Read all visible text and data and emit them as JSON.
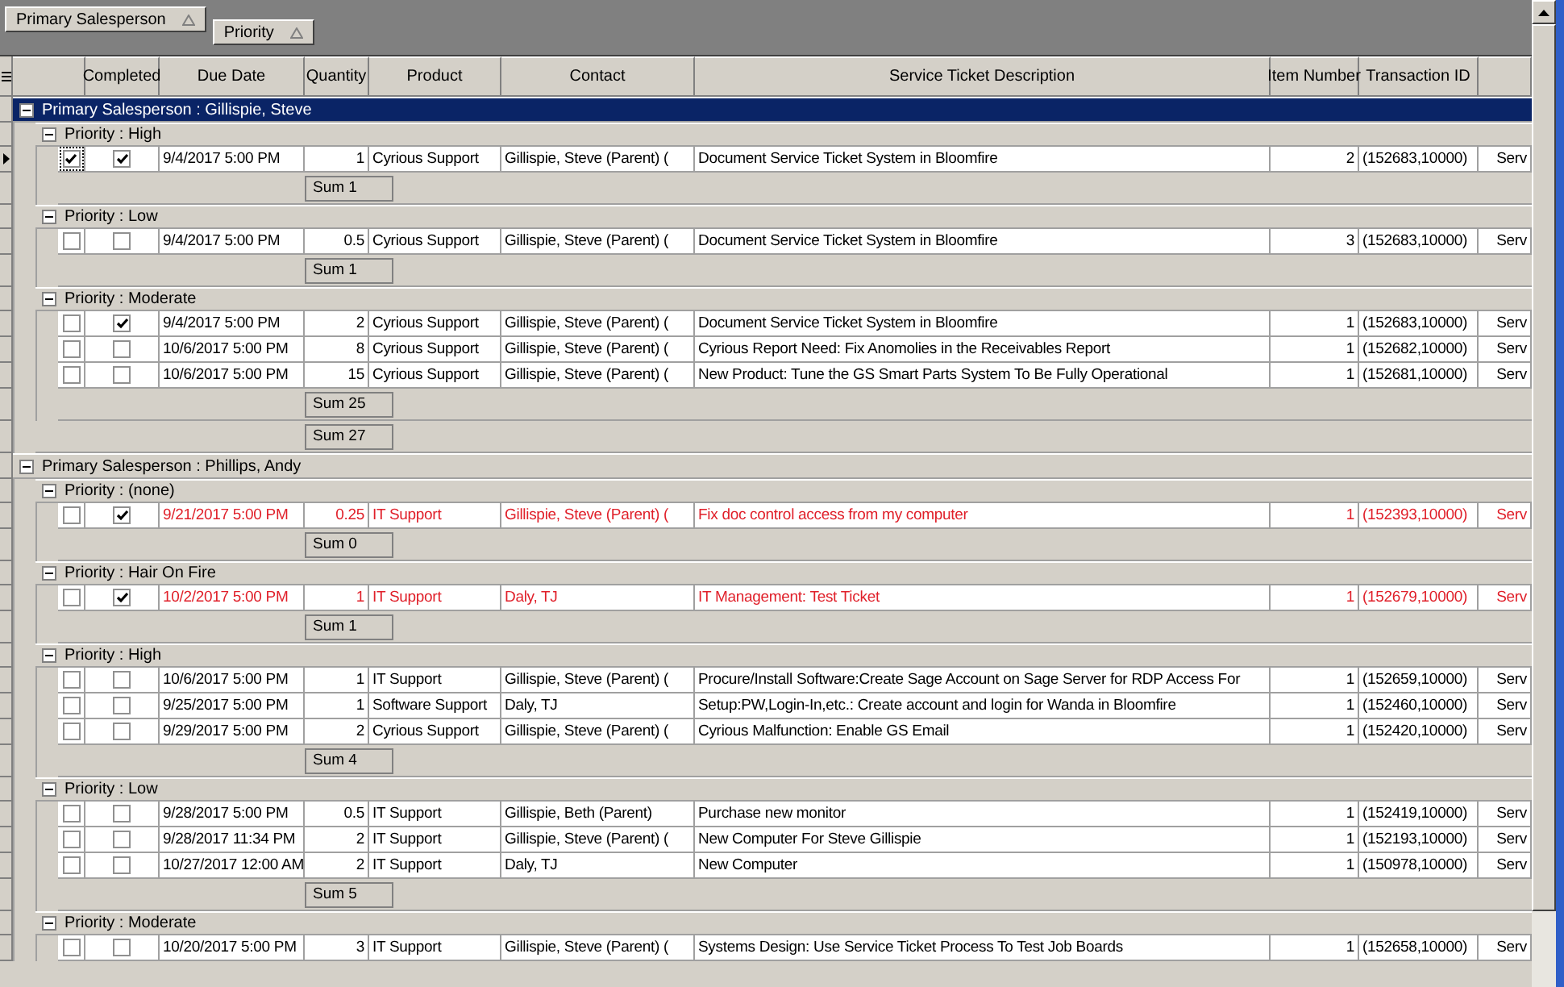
{
  "group_by": [
    {
      "label": "Primary Salesperson"
    },
    {
      "label": "Priority"
    }
  ],
  "columns": [
    "Completed",
    "Due Date",
    "Quantity",
    "Product",
    "Contact",
    "Service Ticket Description",
    "Item Number",
    "Transaction ID"
  ],
  "groups": [
    {
      "label": "Primary Salesperson : Gillispie, Steve",
      "selected": true,
      "expanded": true,
      "sum": "Sum 27",
      "children": [
        {
          "label": "Priority : High",
          "expanded": true,
          "sum": "Sum 1",
          "rows": [
            {
              "selected": true,
              "completed": true,
              "overdue": false,
              "due": "9/4/2017 5:00 PM",
              "quantity": "1",
              "product": "Cyrious Support",
              "contact": "Gillispie, Steve (Parent) (",
              "description": "Document Service Ticket System in Bloomfire",
              "item": "2",
              "transaction": "(152683,10000)",
              "column_10": "Serv"
            }
          ]
        },
        {
          "label": "Priority : Low",
          "expanded": true,
          "sum": "Sum 1",
          "rows": [
            {
              "selected": false,
              "completed": false,
              "overdue": false,
              "due": "9/4/2017 5:00 PM",
              "quantity": "0.5",
              "product": "Cyrious Support",
              "contact": "Gillispie, Steve (Parent) (",
              "description": "Document Service Ticket System in Bloomfire",
              "item": "3",
              "transaction": "(152683,10000)",
              "column_10": "Serv"
            }
          ]
        },
        {
          "label": "Priority : Moderate",
          "expanded": true,
          "sum": "Sum 25",
          "rows": [
            {
              "selected": false,
              "completed": true,
              "overdue": false,
              "due": "9/4/2017 5:00 PM",
              "quantity": "2",
              "product": "Cyrious Support",
              "contact": "Gillispie, Steve (Parent) (",
              "description": "Document Service Ticket System in Bloomfire",
              "item": "1",
              "transaction": "(152683,10000)",
              "column_10": "Serv"
            },
            {
              "selected": false,
              "completed": false,
              "overdue": false,
              "due": "10/6/2017 5:00 PM",
              "quantity": "8",
              "product": "Cyrious Support",
              "contact": "Gillispie, Steve (Parent) (",
              "description": "Cyrious Report Need: Fix Anomolies in the Receivables Report",
              "item": "1",
              "transaction": "(152682,10000)",
              "column_10": "Serv"
            },
            {
              "selected": false,
              "completed": false,
              "overdue": false,
              "due": "10/6/2017 5:00 PM",
              "quantity": "15",
              "product": "Cyrious Support",
              "contact": "Gillispie, Steve (Parent) (",
              "description": "New Product: Tune the GS Smart Parts System To Be Fully Operational",
              "item": "1",
              "transaction": "(152681,10000)",
              "column_10": "Serv"
            }
          ]
        }
      ]
    },
    {
      "label": "Primary Salesperson : Phillips, Andy",
      "selected": false,
      "expanded": true,
      "children": [
        {
          "label": "Priority : (none)",
          "expanded": true,
          "sum": "Sum 0",
          "rows": [
            {
              "selected": false,
              "completed": true,
              "overdue": true,
              "due": "9/21/2017 5:00 PM",
              "quantity": "0.25",
              "product": "IT Support",
              "contact": "Gillispie, Steve (Parent) (",
              "description": "Fix doc control access from my computer",
              "item": "1",
              "transaction": "(152393,10000)",
              "column_10": "Serv"
            }
          ]
        },
        {
          "label": "Priority : Hair On Fire",
          "expanded": true,
          "sum": "Sum 1",
          "rows": [
            {
              "selected": false,
              "completed": true,
              "overdue": true,
              "due": "10/2/2017 5:00 PM",
              "quantity": "1",
              "product": "IT Support",
              "contact": "Daly, TJ",
              "description": "IT Management: Test Ticket",
              "item": "1",
              "transaction": "(152679,10000)",
              "column_10": "Serv"
            }
          ]
        },
        {
          "label": "Priority : High",
          "expanded": true,
          "sum": "Sum 4",
          "rows": [
            {
              "selected": false,
              "completed": false,
              "overdue": false,
              "due": "10/6/2017 5:00 PM",
              "quantity": "1",
              "product": "IT Support",
              "contact": "Gillispie, Steve (Parent) (",
              "description": "Procure/Install Software:Create Sage Account on Sage Server for RDP Access For",
              "item": "1",
              "transaction": "(152659,10000)",
              "column_10": "Serv"
            },
            {
              "selected": false,
              "completed": false,
              "overdue": false,
              "due": "9/25/2017 5:00 PM",
              "quantity": "1",
              "product": "Software Support",
              "contact": "Daly, TJ",
              "description": "Setup:PW,Login-In,etc.: Create account and login for Wanda in Bloomfire",
              "item": "1",
              "transaction": "(152460,10000)",
              "column_10": "Serv"
            },
            {
              "selected": false,
              "completed": false,
              "overdue": false,
              "due": "9/29/2017 5:00 PM",
              "quantity": "2",
              "product": "Cyrious Support",
              "contact": "Gillispie, Steve (Parent) (",
              "description": "Cyrious Malfunction: Enable GS Email",
              "item": "1",
              "transaction": "(152420,10000)",
              "column_10": "Serv"
            }
          ]
        },
        {
          "label": "Priority : Low",
          "expanded": true,
          "sum": "Sum 5",
          "rows": [
            {
              "selected": false,
              "completed": false,
              "overdue": false,
              "due": "9/28/2017 5:00 PM",
              "quantity": "0.5",
              "product": "IT Support",
              "contact": "Gillispie, Beth (Parent)",
              "description": "Purchase new monitor",
              "item": "1",
              "transaction": "(152419,10000)",
              "column_10": "Serv"
            },
            {
              "selected": false,
              "completed": false,
              "overdue": false,
              "due": "9/28/2017 11:34 PM",
              "quantity": "2",
              "product": "IT Support",
              "contact": "Gillispie, Steve (Parent) (",
              "description": "New Computer For Steve Gillispie",
              "item": "1",
              "transaction": "(152193,10000)",
              "column_10": "Serv"
            },
            {
              "selected": false,
              "completed": false,
              "overdue": false,
              "due": "10/27/2017 12:00 AM",
              "quantity": "2",
              "product": "IT Support",
              "contact": "Daly, TJ",
              "description": "New Computer",
              "item": "1",
              "transaction": "(150978,10000)",
              "column_10": "Serv"
            }
          ]
        },
        {
          "label": "Priority : Moderate",
          "expanded": true,
          "rows": [
            {
              "selected": false,
              "completed": false,
              "overdue": false,
              "due": "10/20/2017 5:00 PM",
              "quantity": "3",
              "product": "IT Support",
              "contact": "Gillispie, Steve (Parent) (",
              "description": "Systems Design: Use Service Ticket Process To Test Job Boards",
              "item": "1",
              "transaction": "(152658,10000)",
              "column_10": "Serv"
            }
          ]
        }
      ]
    }
  ]
}
